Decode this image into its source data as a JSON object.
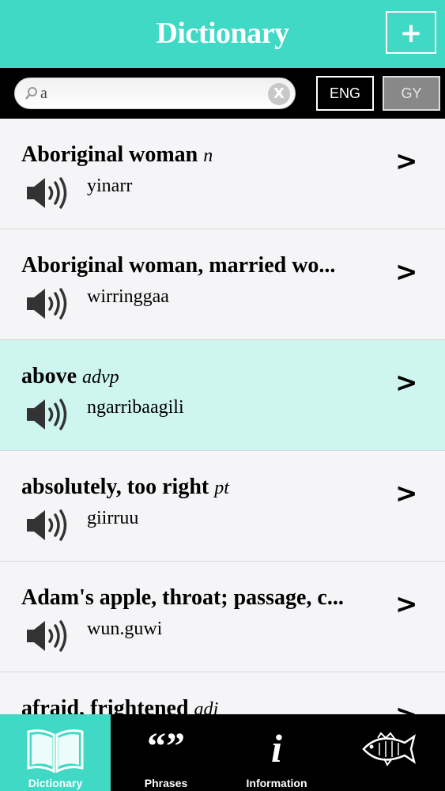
{
  "header": {
    "title": "Dictionary",
    "add_label": "+"
  },
  "search": {
    "value": "a",
    "clear_label": "X"
  },
  "lang": {
    "eng": "ENG",
    "gy": "GY"
  },
  "entries": [
    {
      "headword": "Aboriginal woman",
      "pos": "n",
      "translation": "yinarr"
    },
    {
      "headword": "Aboriginal woman, married wo...",
      "pos": "",
      "translation": "wirringgaa"
    },
    {
      "headword": "above",
      "pos": "advp",
      "translation": "ngarribaagili"
    },
    {
      "headword": "absolutely, too right",
      "pos": "pt",
      "translation": "giirruu"
    },
    {
      "headword": "Adam's apple, throat; passage, c...",
      "pos": "",
      "translation": "wun.guwi"
    },
    {
      "headword": "afraid, frightened",
      "pos": "adj",
      "translation": ""
    }
  ],
  "chevron": ">",
  "tabs": [
    {
      "label": "Dictionary",
      "icon": "book-icon"
    },
    {
      "label": "Phrases",
      "icon": "quotes-icon"
    },
    {
      "label": "Information",
      "icon": "info-icon"
    },
    {
      "label": "",
      "icon": "fish-icon"
    }
  ],
  "colors": {
    "accent": "#3fd9c6",
    "selected_row": "#cef5f0",
    "bar": "#000000"
  }
}
